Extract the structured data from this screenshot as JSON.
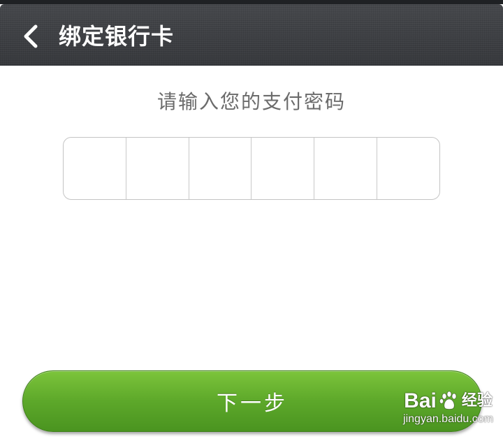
{
  "header": {
    "title": "绑定银行卡",
    "back_icon": "chevron-left-icon"
  },
  "prompt": "请输入您的支付密码",
  "pin": {
    "cells": [
      "",
      "",
      "",
      "",
      "",
      ""
    ]
  },
  "actions": {
    "next_label": "下一步"
  },
  "watermark": {
    "brand_left": "Bai",
    "brand_right": "经验",
    "url": "jingyan.baidu.com"
  },
  "colors": {
    "titlebar": "#3b3d41",
    "accent_green": "#5da82a",
    "prompt_text": "#6b6b6b",
    "border": "#c4c4c4"
  }
}
